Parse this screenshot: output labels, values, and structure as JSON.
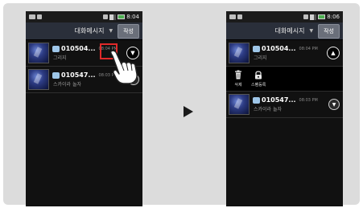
{
  "left_phone": {
    "status_time": "8:04",
    "title": "대화메시지",
    "compose_label": "작성",
    "threads": [
      {
        "number": "010504...",
        "time": "08:04 PM",
        "preview": "그리지"
      },
      {
        "number": "010547...",
        "time": "08:03 PM",
        "preview": "스카이라 놀자"
      }
    ]
  },
  "right_phone": {
    "status_time": "8:06",
    "title": "대화메시지",
    "compose_label": "작성",
    "threads": [
      {
        "number": "010504...",
        "time": "08:04 PM",
        "preview": "그리지"
      },
      {
        "number": "010547...",
        "time": "08:03 PM",
        "preview": "스카이라 놀자"
      }
    ],
    "actions": [
      {
        "label": "삭제",
        "icon": "trash-icon"
      },
      {
        "label": "스팸등록",
        "icon": "spam-lock-icon"
      }
    ]
  },
  "colors": {
    "highlight": "#e02a2a",
    "titlebar": "#2a2f3a"
  }
}
